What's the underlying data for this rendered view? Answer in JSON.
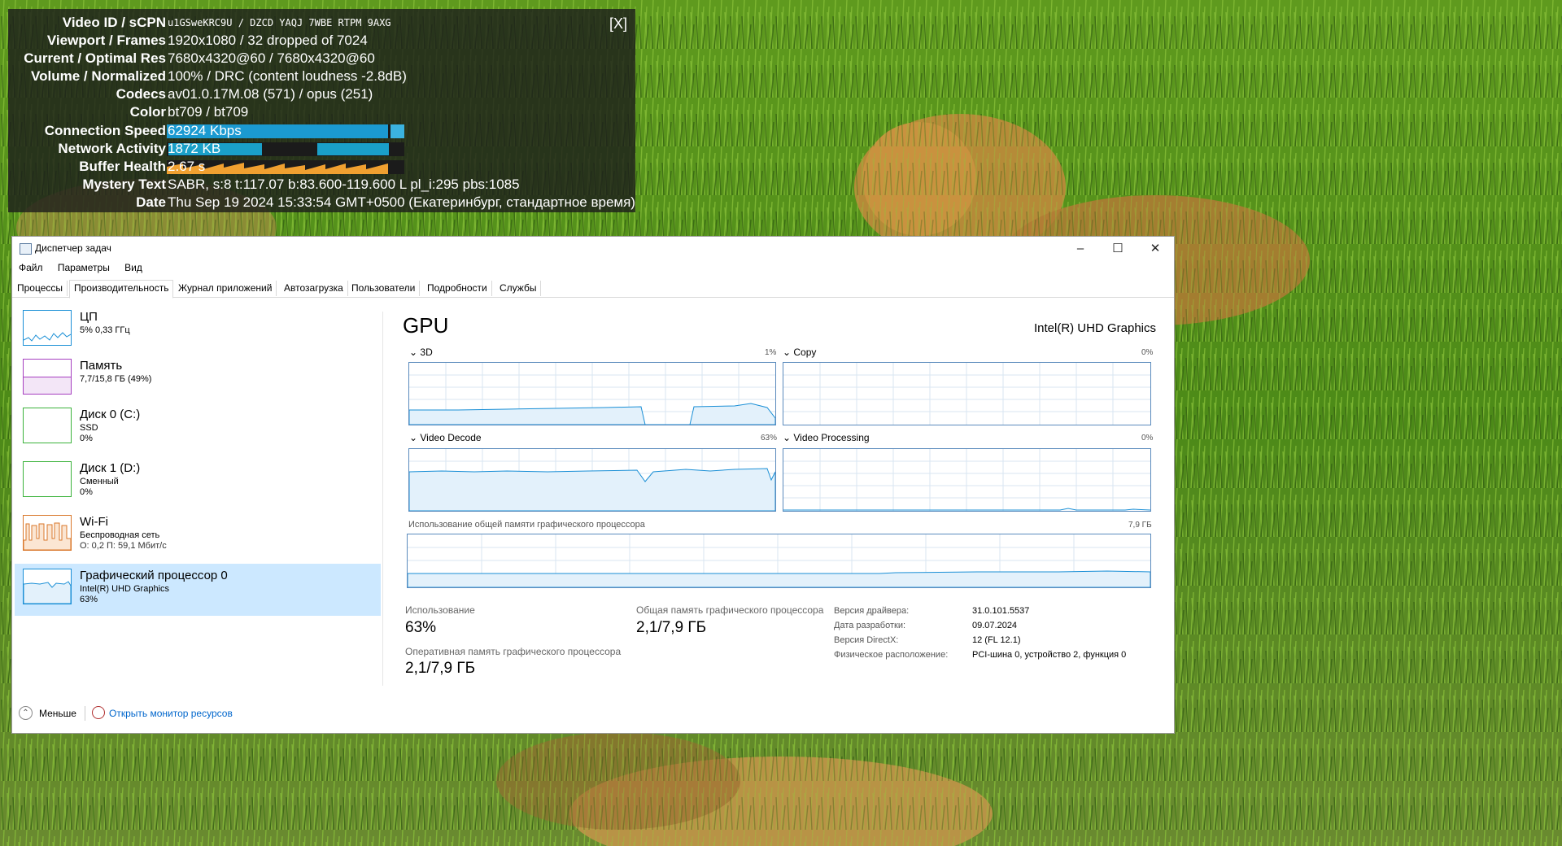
{
  "stats": {
    "close": "[X]",
    "rows": [
      {
        "label": "Video ID / sCPN",
        "value": "u1GSweKRC9U / DZCD YAQJ 7WBE RTPM 9AXG"
      },
      {
        "label": "Viewport / Frames",
        "value": "1920x1080 / 32 dropped of 7024"
      },
      {
        "label": "Current / Optimal Res",
        "value": "7680x4320@60 / 7680x4320@60"
      },
      {
        "label": "Volume / Normalized",
        "value": "100% / DRC (content loudness -2.8dB)"
      },
      {
        "label": "Codecs",
        "value": "av01.0.17M.08 (571) / opus (251)"
      },
      {
        "label": "Color",
        "value": "bt709 / bt709"
      },
      {
        "label": "Connection Speed",
        "value": "62924 Kbps"
      },
      {
        "label": "Network Activity",
        "value": "1872 KB"
      },
      {
        "label": "Buffer Health",
        "value": "2.67 s"
      },
      {
        "label": "Mystery Text",
        "value": "SABR, s:8 t:117.07 b:83.600-119.600 L pl_i:295 pbs:1085"
      },
      {
        "label": "Date",
        "value": "Thu Sep 19 2024 15:33:54 GMT+0500 (Екатеринбург, стандартное время)"
      }
    ]
  },
  "taskmgr": {
    "title": "Диспетчер задач",
    "menu": [
      "Файл",
      "Параметры",
      "Вид"
    ],
    "tabs": [
      "Процессы",
      "Производительность",
      "Журнал приложений",
      "Автозагрузка",
      "Пользователи",
      "Подробности",
      "Службы"
    ],
    "active_tab": "Производительность",
    "side": [
      {
        "name": "ЦП",
        "line1": "5% 0,33 ГГц",
        "line2": "",
        "color": "#1a8fd6"
      },
      {
        "name": "Память",
        "line1": "7,7/15,8 ГБ (49%)",
        "line2": "",
        "color": "#a63ec0"
      },
      {
        "name": "Диск 0 (C:)",
        "line1": "SSD",
        "line2": "0%",
        "color": "#3bb33b"
      },
      {
        "name": "Диск 1 (D:)",
        "line1": "Сменный",
        "line2": "0%",
        "color": "#3bb33b"
      },
      {
        "name": "Wi-Fi",
        "line1": "Беспроводная сеть",
        "line2": "О: 0,2 П: 59,1 Мбит/с",
        "color": "#d9772a"
      },
      {
        "name": "Графический процессор 0",
        "line1": "Intel(R) UHD Graphics",
        "line2": "63%",
        "color": "#1a8fd6"
      }
    ],
    "gpu": {
      "heading": "GPU",
      "model": "Intel(R) UHD Graphics",
      "engines": [
        {
          "name": "3D",
          "pct": "1%"
        },
        {
          "name": "Copy",
          "pct": "0%"
        },
        {
          "name": "Video Decode",
          "pct": "63%"
        },
        {
          "name": "Video Processing",
          "pct": "0%"
        }
      ],
      "shared_label": "Использование общей памяти графического процессора",
      "shared_max": "7,9 ГБ",
      "usage_label": "Использование",
      "usage_value": "63%",
      "shared_mem_label": "Общая память графического процессора",
      "shared_mem_value": "2,1/7,9 ГБ",
      "dedicated_label": "Оперативная память графического процессора",
      "dedicated_value": "2,1/7,9 ГБ",
      "props": [
        {
          "k": "Версия драйвера:",
          "v": "31.0.101.5537"
        },
        {
          "k": "Дата разработки:",
          "v": "09.07.2024"
        },
        {
          "k": "Версия DirectX:",
          "v": "12 (FL 12.1)"
        },
        {
          "k": "Физическое расположение:",
          "v": "PCI-шина 0, устройство 2, функция 0"
        }
      ]
    },
    "footer": {
      "less": "Меньше",
      "monitor": "Открыть монитор ресурсов"
    }
  }
}
